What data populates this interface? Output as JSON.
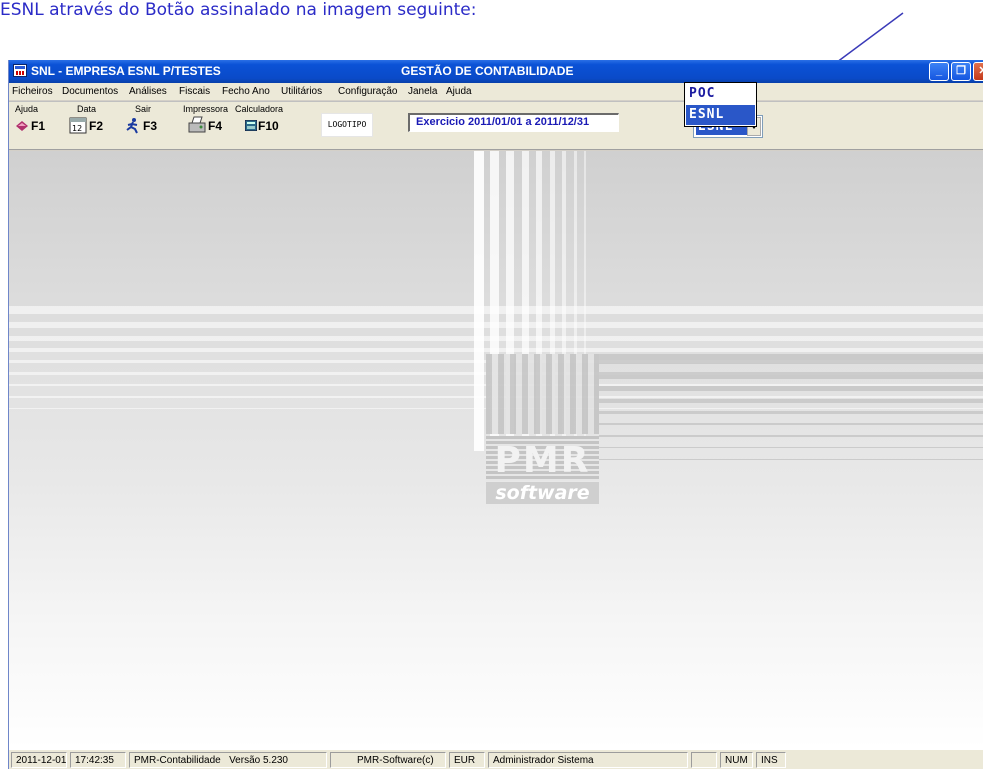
{
  "caption": "ESNL através do Botão assinalado na imagem seguinte:",
  "titlebar": {
    "title": "SNL - EMPRESA ESNL P/TESTES",
    "module": "GESTÃO DE CONTABILIDADE"
  },
  "menu": [
    "Ficheiros",
    "Documentos",
    "Análises",
    "Fiscais",
    "Fecho Ano",
    "Utilitários",
    "Configuração",
    "Janela",
    "Ajuda"
  ],
  "toolbar": {
    "help": {
      "label": "Ajuda",
      "key": "F1"
    },
    "date": {
      "label": "Data",
      "key": "F2"
    },
    "exit": {
      "label": "Sair",
      "key": "F3"
    },
    "printer": {
      "label": "Impressora",
      "key": "F4"
    },
    "calculator": {
      "label": "Calculadora",
      "key": "F10"
    },
    "logo": "LOGOTIPO",
    "period": "Exercicio 2011/01/01 a 2011/12/31",
    "plan_selected": "ESNL",
    "plan_options": [
      "POC",
      "ESNL"
    ]
  },
  "brand": {
    "name": "PMR",
    "tag": "software"
  },
  "status": {
    "date": "2011-12-01",
    "time": "17:42:35",
    "app": "PMR-Contabilidade",
    "version": "Versão 5.230",
    "copyright": "PMR-Software(c)",
    "currency": "EUR",
    "user": "Administrador Sistema",
    "blank": "",
    "num": "NUM",
    "ins": "INS"
  },
  "colors": {
    "caption": "#2b2bc7",
    "arrow": "#3a3ab8",
    "titlebar": "#0a4ac8",
    "selection": "#2a57c8",
    "period_text": "#1a1ab5"
  }
}
